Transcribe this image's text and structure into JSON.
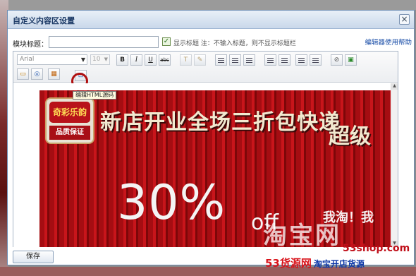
{
  "dialog": {
    "title": "自定义内容区设置",
    "close_label": "×"
  },
  "form": {
    "title_label": "模块标题：",
    "title_value": "",
    "show_title_checked": "✓",
    "show_title_label": "显示标题 注：不输入标题，则不显示标题栏",
    "help_link": "编辑器使用帮助"
  },
  "toolbar": {
    "font_family": "Arial",
    "font_size": "10",
    "bold": "B",
    "italic": "I",
    "underline": "U",
    "strikethrough": "abc",
    "tooltip": "编辑HTML源码"
  },
  "banner": {
    "badge_top": "奇彩乐韵",
    "badge_bottom": "品质保证",
    "headline": "新店开业全场三折包快递",
    "super_text": "超级",
    "discount": "30%",
    "off_text": "off",
    "slogan": "我淘！我"
  },
  "footer": {
    "save_label": "保存"
  },
  "watermark": {
    "big": "淘宝网",
    "domain": "53shop.com",
    "site_name": "53货源网",
    "site_tagline": "淘宝开店货源"
  },
  "colors": {
    "accent": "#1b4fa8",
    "banner_red": "#a50d12",
    "highlight_ring": "#b01010"
  }
}
